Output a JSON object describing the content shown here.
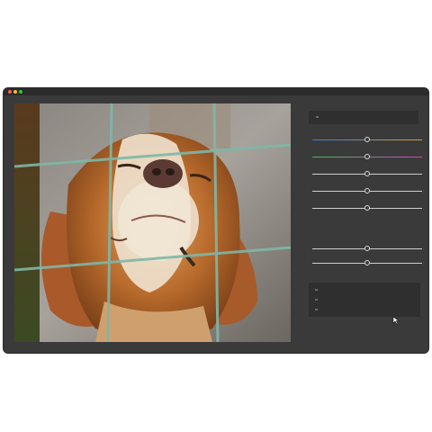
{
  "window": {
    "traffic_lights": [
      {
        "name": "close",
        "color": "#ff5f57"
      },
      {
        "name": "minimize",
        "color": "#febc2e"
      },
      {
        "name": "zoom",
        "color": "#28c840"
      }
    ]
  },
  "canvas": {
    "image": "dog-photo",
    "grid_overlay": "rule-of-thirds",
    "grid_color": "#7fb7a8"
  },
  "panel": {
    "sliders": [
      {
        "name": "slider-1",
        "value": 0.5,
        "gradient": [
          "#3d7bd6",
          "#d6a03d"
        ]
      },
      {
        "name": "slider-2",
        "value": 0.5,
        "gradient": [
          "#3dbf4a",
          "#d63dd0"
        ]
      },
      {
        "name": "slider-3",
        "value": 0.5,
        "gradient": [
          "#cfcfcf",
          "#cfcfcf"
        ]
      },
      {
        "name": "slider-4",
        "value": 0.5,
        "gradient": [
          "#cfcfcf",
          "#cfcfcf"
        ]
      },
      {
        "name": "slider-5",
        "value": 0.5,
        "gradient": [
          "#cfcfcf",
          "#cfcfcf"
        ]
      },
      {
        "name": "slider-6",
        "value": 0.5,
        "gradient": [
          "#cfcfcf",
          "#cfcfcf"
        ]
      },
      {
        "name": "slider-7",
        "value": 0.5,
        "gradient": [
          "#cfcfcf",
          "#cfcfcf"
        ]
      }
    ]
  },
  "colors": {
    "window_bg": "#3a3a3a",
    "titlebar_bg": "#2b2b2b",
    "panel_box_bg": "#2f2f2f"
  }
}
